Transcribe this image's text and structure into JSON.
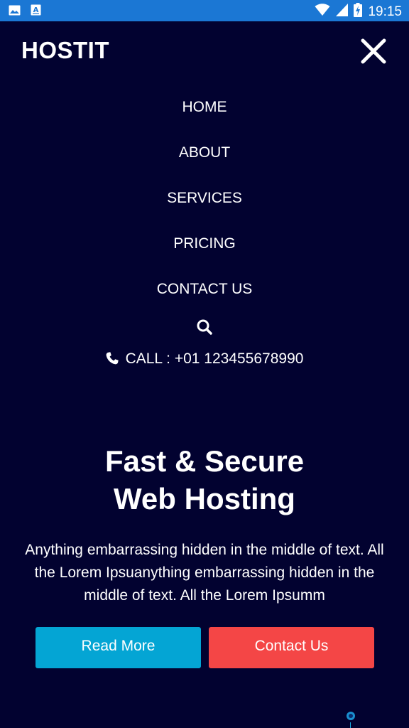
{
  "status_bar": {
    "time": "19:15",
    "icons": [
      "image-icon",
      "font-icon",
      "wifi-icon",
      "signal-icon",
      "battery-charging-icon"
    ]
  },
  "header": {
    "brand": "HOSTIT",
    "close_icon": "close-icon"
  },
  "nav": {
    "items": [
      {
        "label": "HOME"
      },
      {
        "label": "ABOUT"
      },
      {
        "label": "SERVICES"
      },
      {
        "label": "PRICING"
      },
      {
        "label": "CONTACT US"
      }
    ],
    "search_icon": "search-icon"
  },
  "contact": {
    "call_text": "CALL : +01 123455678990",
    "phone_icon": "phone-icon"
  },
  "hero": {
    "title_line1": "Fast & Secure",
    "title_line2": "Web Hosting",
    "text": "Anything embarrassing hidden in the middle of text. All the Lorem Ipsuanything embarrassing hidden in the middle of text. All the Lorem Ipsumm",
    "read_more_label": "Read More",
    "contact_label": "Contact Us"
  },
  "colors": {
    "background": "#020230",
    "status_bar": "#1b77d4",
    "read_more": "#04a5d4",
    "contact": "#f44646"
  }
}
